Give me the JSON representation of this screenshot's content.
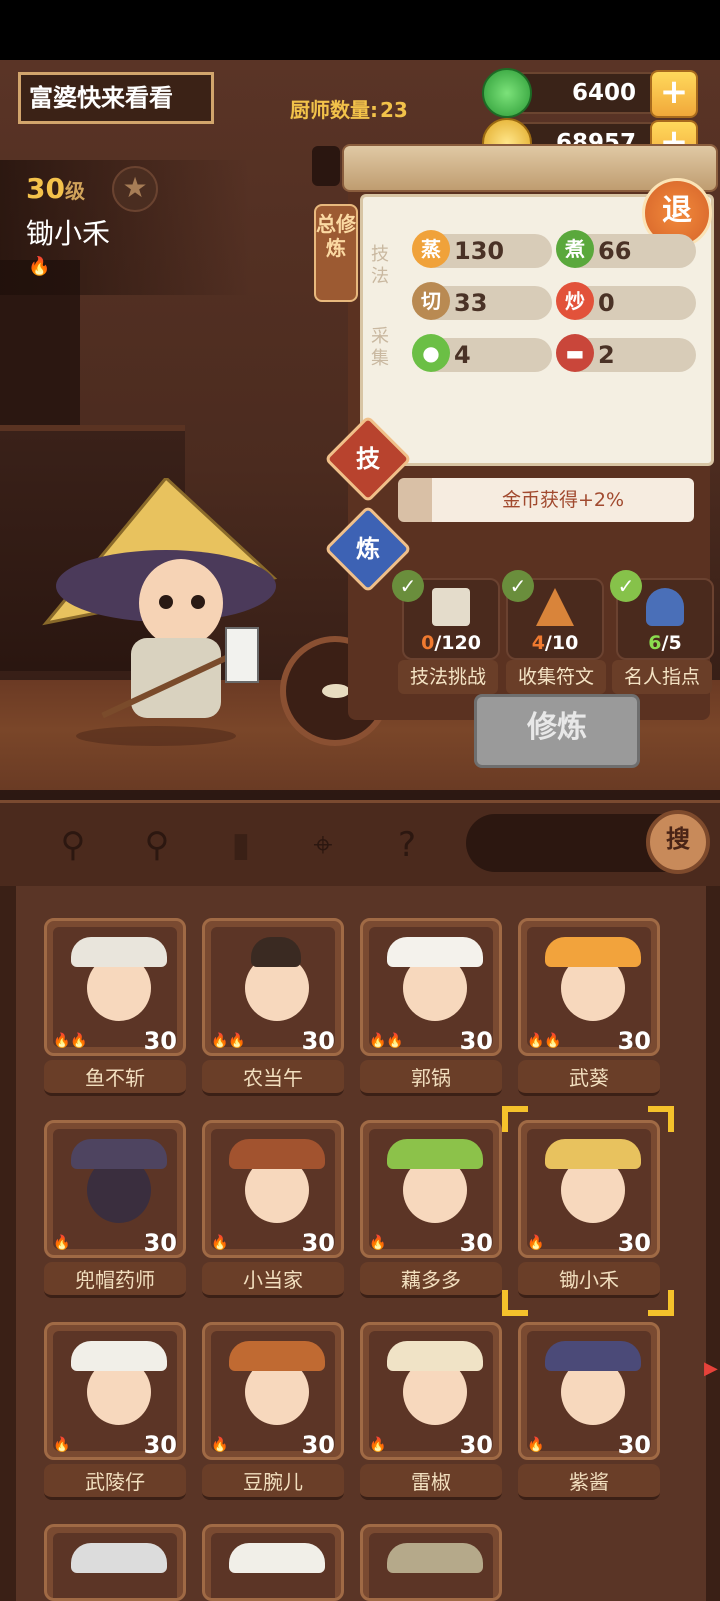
{
  "header": {
    "title": "富婆快来看看",
    "chef_count_label": "厨师数量:",
    "chef_count_value": "23"
  },
  "resources": {
    "jade": "6400",
    "gold": "68957",
    "plus": "+"
  },
  "selected_chef": {
    "level": "30",
    "level_unit": "级",
    "name": "锄小禾"
  },
  "panel": {
    "tab_label": "总修炼",
    "exit_label": "退",
    "technique_label": "技法",
    "collect_label": "采集",
    "stats": {
      "steam": {
        "icon": "蒸",
        "value": "130"
      },
      "boil": {
        "icon": "煮",
        "value": "66"
      },
      "cut": {
        "icon": "切",
        "value": "33"
      },
      "fry": {
        "icon": "炒",
        "value": "0"
      },
      "veg": {
        "value": "4"
      },
      "meat": {
        "value": "2"
      }
    },
    "tab_skill": "技",
    "tab_refine": "炼",
    "bonus": "金币获得+2%",
    "tasks": [
      {
        "current": "0",
        "total": "/120",
        "label": "技法挑战"
      },
      {
        "current": "4",
        "total": "/10",
        "label": "收集符文"
      },
      {
        "current": "6",
        "total": "/5",
        "label": "名人指点"
      }
    ],
    "train_button": "修炼"
  },
  "toolbar": {
    "search_button": "搜"
  },
  "chefs": [
    {
      "name": "鱼不斩",
      "level": "30"
    },
    {
      "name": "农当午",
      "level": "30"
    },
    {
      "name": "郭锅",
      "level": "30"
    },
    {
      "name": "武葵",
      "level": "30"
    },
    {
      "name": "兜帽药师",
      "level": "30"
    },
    {
      "name": "小当家",
      "level": "30"
    },
    {
      "name": "藕多多",
      "level": "30"
    },
    {
      "name": "锄小禾",
      "level": "30"
    },
    {
      "name": "武陵仔",
      "level": "30"
    },
    {
      "name": "豆腕儿",
      "level": "30"
    },
    {
      "name": "雷椒",
      "level": "30"
    },
    {
      "name": "紫酱",
      "level": "30"
    }
  ]
}
